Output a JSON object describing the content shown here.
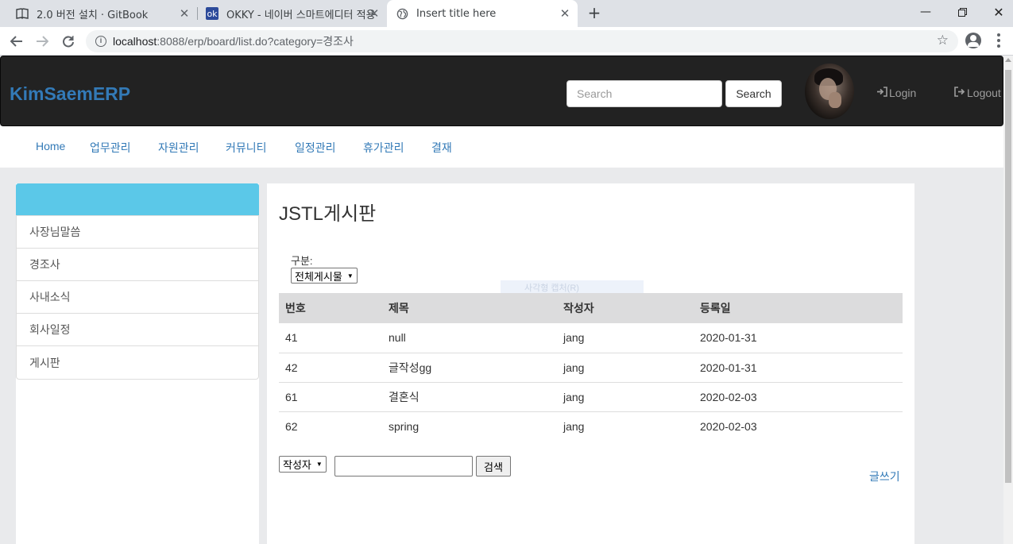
{
  "browser": {
    "tabs": [
      {
        "title": "2.0 버전 설치 · GitBook",
        "icon": "book-icon",
        "active": false
      },
      {
        "title": "OKKY - 네이버 스마트에디터 적용",
        "icon": "okky-icon",
        "active": false
      },
      {
        "title": "Insert title here",
        "icon": "globe-icon",
        "active": true
      }
    ],
    "url_host": "localhost",
    "url_path": ":8088/erp/board/list.do?category=경조사"
  },
  "header": {
    "brand": "KimSaemERP",
    "search_placeholder": "Search",
    "search_button": "Search",
    "login_label": "Login",
    "logout_label": "Logout"
  },
  "menu": {
    "items": [
      "Home",
      "업무관리",
      "자원관리",
      "커뮤니티",
      "일정관리",
      "휴가관리",
      "결재"
    ]
  },
  "sidebar": {
    "items": [
      "사장님말씀",
      "경조사",
      "사내소식",
      "회사일정",
      "게시판"
    ]
  },
  "board": {
    "title": "JSTL게시판",
    "category_label": "구분:",
    "category_selected": "전체게시물",
    "ghost_text": "사각형 캡처(R)",
    "columns": [
      "번호",
      "제목",
      "작성자",
      "등록일"
    ],
    "rows": [
      [
        "41",
        "null",
        "jang",
        "2020-01-31"
      ],
      [
        "42",
        "글작성gg",
        "jang",
        "2020-01-31"
      ],
      [
        "61",
        "결혼식",
        "jang",
        "2020-02-03"
      ],
      [
        "62",
        "spring",
        "jang",
        "2020-02-03"
      ]
    ],
    "search_field": "작성자",
    "search_button": "검색",
    "write_link": "글쓰기"
  }
}
